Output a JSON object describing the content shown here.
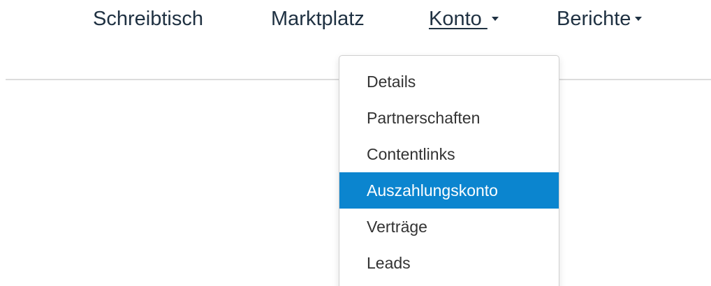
{
  "nav": {
    "items": [
      {
        "label": "Schreibtisch"
      },
      {
        "label": "Marktplatz"
      },
      {
        "label": "Konto "
      },
      {
        "label": "Berichte"
      }
    ]
  },
  "dropdown": {
    "items": [
      {
        "label": "Details"
      },
      {
        "label": "Partnerschaften"
      },
      {
        "label": "Contentlinks"
      },
      {
        "label": "Auszahlungskonto"
      },
      {
        "label": "Verträge"
      },
      {
        "label": "Leads"
      }
    ],
    "selected": "Auszahlungskonto"
  },
  "colors": {
    "nav_text": "#1f3142",
    "highlight": "#0b85cf",
    "divider": "#dcdcdc"
  }
}
